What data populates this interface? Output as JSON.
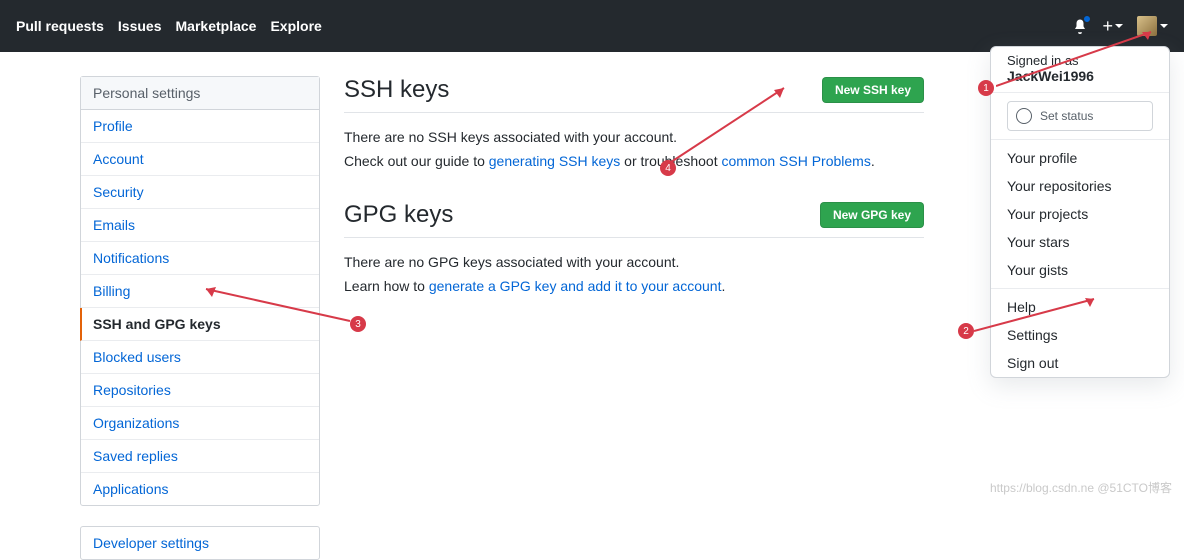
{
  "header": {
    "nav": [
      "Pull requests",
      "Issues",
      "Marketplace",
      "Explore"
    ]
  },
  "sidebar": {
    "title": "Personal settings",
    "items": [
      {
        "label": "Profile"
      },
      {
        "label": "Account"
      },
      {
        "label": "Security"
      },
      {
        "label": "Emails"
      },
      {
        "label": "Notifications"
      },
      {
        "label": "Billing"
      },
      {
        "label": "SSH and GPG keys",
        "active": true
      },
      {
        "label": "Blocked users"
      },
      {
        "label": "Repositories"
      },
      {
        "label": "Organizations"
      },
      {
        "label": "Saved replies"
      },
      {
        "label": "Applications"
      }
    ],
    "dev_link": "Developer settings"
  },
  "ssh": {
    "title": "SSH keys",
    "button": "New SSH key",
    "empty": "There are no SSH keys associated with your account.",
    "guide_prefix": "Check out our guide to ",
    "guide_link1": "generating SSH keys",
    "guide_mid": " or troubleshoot ",
    "guide_link2": "common SSH Problems",
    "guide_suffix": "."
  },
  "gpg": {
    "title": "GPG keys",
    "button": "New GPG key",
    "empty": "There are no GPG keys associated with your account.",
    "learn_prefix": "Learn how to ",
    "learn_link": "generate a GPG key and add it to your account",
    "learn_suffix": "."
  },
  "dropdown": {
    "signed_in": "Signed in as",
    "username": "JackWei1996",
    "set_status": "Set status",
    "items1": [
      "Your profile",
      "Your repositories",
      "Your projects",
      "Your stars",
      "Your gists"
    ],
    "items2": [
      "Help",
      "Settings",
      "Sign out"
    ]
  },
  "annotations": {
    "b1": "1",
    "b2": "2",
    "b3": "3",
    "b4": "4"
  },
  "watermark": "https://blog.csdn.ne @51CTO博客"
}
